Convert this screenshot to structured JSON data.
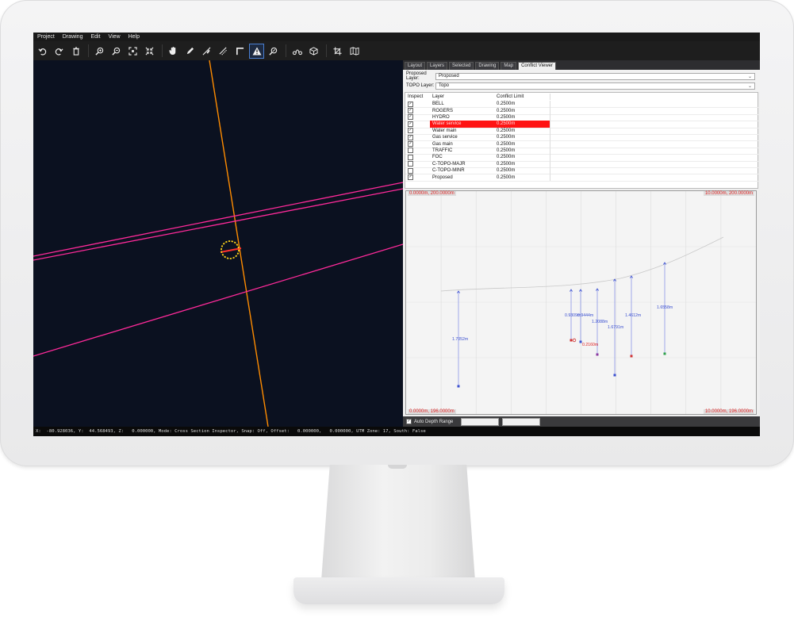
{
  "menu": [
    "Project",
    "Drawing",
    "Edit",
    "View",
    "Help"
  ],
  "toolbar": {
    "icons": [
      "undo-icon",
      "redo-icon",
      "delete-icon",
      "zoom-in-icon",
      "zoom-out-icon",
      "zoom-extents-icon",
      "zoom-fit-icon",
      "pan-hand-icon",
      "pencil-icon",
      "edit-line-icon",
      "draw-line-icon",
      "corner-icon",
      "warning-icon",
      "inspect-icon",
      "route-icon",
      "cube-icon",
      "crop-icon",
      "map-book-icon"
    ],
    "active": "warning-icon"
  },
  "tabs": [
    "Layout",
    "Layers",
    "Selected",
    "Drawing",
    "Map",
    "Conflict Viewer"
  ],
  "active_tab": "Conflict Viewer",
  "form": {
    "proposed_label": "Proposed Layer:",
    "proposed_value": "Proposed",
    "topo_label": "TOPO Layer:",
    "topo_value": "Topo"
  },
  "grid": {
    "headers": {
      "inspect": "Inspect",
      "layer": "Layer",
      "limit": "Conflict Limit"
    },
    "rows": [
      {
        "layer": "BELL",
        "limit": "0.2500m",
        "checked": true,
        "highlight": false
      },
      {
        "layer": "ROGERS",
        "limit": "0.2500m",
        "checked": true,
        "highlight": false
      },
      {
        "layer": "HYDRO",
        "limit": "0.2500m",
        "checked": true,
        "highlight": false
      },
      {
        "layer": "Water service",
        "limit": "0.2500m",
        "checked": true,
        "highlight": true
      },
      {
        "layer": "Water main",
        "limit": "0.2500m",
        "checked": true,
        "highlight": false
      },
      {
        "layer": "Gas service",
        "limit": "0.2500m",
        "checked": true,
        "highlight": false
      },
      {
        "layer": "Gas main",
        "limit": "0.2500m",
        "checked": true,
        "highlight": false
      },
      {
        "layer": "TRAFFIC",
        "limit": "0.2500m",
        "checked": false,
        "highlight": false
      },
      {
        "layer": "FOC",
        "limit": "0.2500m",
        "checked": false,
        "highlight": false
      },
      {
        "layer": "C-TOPO-MAJR",
        "limit": "0.2500m",
        "checked": false,
        "highlight": false
      },
      {
        "layer": "C-TOPO-MINR",
        "limit": "0.2500m",
        "checked": false,
        "highlight": false
      },
      {
        "layer": "Proposed",
        "limit": "0.2500m",
        "checked": true,
        "highlight": false
      }
    ]
  },
  "xsection": {
    "corner_tl": "0.0000m, 200.0000m",
    "corner_tr": "10.0000m, 200.0000m",
    "corner_bl": "0.0000m, 196.0000m",
    "corner_br": "10.0000m, 196.0000m",
    "depth_labels": [
      "1.7052m",
      "0.9309m",
      "0.9444m",
      "1.2088m",
      "0.2160m",
      "1.6791m",
      "1.4612m",
      "1.6558m"
    ]
  },
  "bottom": {
    "auto_depth_label": "Auto Depth Range",
    "checked": true
  },
  "status": "X:  -80.928036, Y:  44.568493, Z:   0.000000, Mode: Cross Section Inspector, Snap: Off, Offset:   0.000000,   0.000000, UTM Zone: 17, South: False",
  "colors": {
    "accent": "#4a7fd0",
    "highlight": "#ff1414",
    "pipe": "#ff2a9a",
    "road": "#ff8c00",
    "conflict": "#ffd21a"
  }
}
